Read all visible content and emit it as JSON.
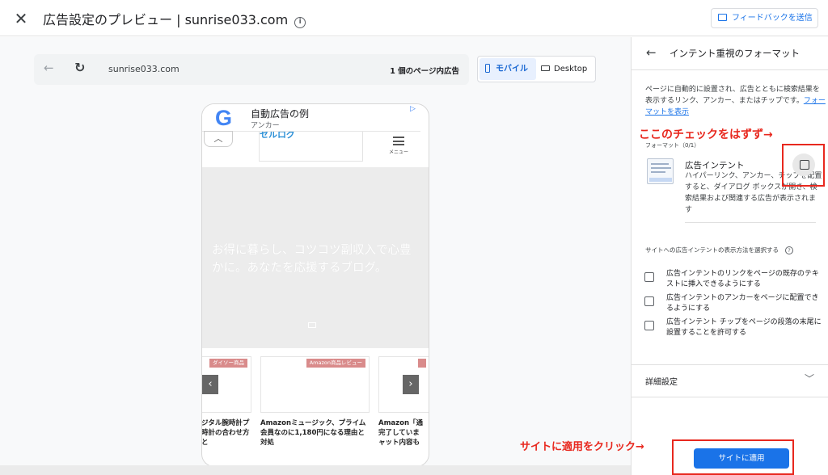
{
  "header": {
    "close_icon": "close-icon",
    "title": "広告設定のプレビュー | sunrise033.com",
    "info_icon": "info-icon",
    "feedback_label": "フィードバックを送信"
  },
  "preview_bar": {
    "url": "sunrise033.com",
    "ad_count": "1 個のページ内広告",
    "device_mobile": "モバイル",
    "device_desktop": "Desktop"
  },
  "phone": {
    "ad_title": "自動広告の例",
    "ad_subtitle": "アンカー",
    "google_logo": "G",
    "menu_label": "メニュー",
    "site_logo": "セルログ",
    "hero_text": "お得に暮らし、コツコツ副収入で心豊かに。あなたを応援するブログ。",
    "cards": [
      {
        "tag": "ダイソー商品",
        "caption": "ジタル腕時計プ\n時計の合わせ方と"
      },
      {
        "tag": "Amazon商品レビュー",
        "caption": "Amazonミュージック、プライム会員なのに1,180円になる理由と対処"
      },
      {
        "tag": "",
        "caption": "Amazon「通\n完了していま\nャット内容も"
      }
    ],
    "prev_label": "‹",
    "next_label": "›"
  },
  "panel": {
    "title": "インテント重視のフォーマット",
    "description": "ページに自動的に設置され、広告とともに検索結果を表示するリンク、アンカー、またはチップです。",
    "description_link": "フォーマットを表示",
    "format_count": "フォーマット（0/1）",
    "format_name": "広告インテント",
    "format_description": "ハイパーリンク、アンカー、チップを配置すると、ダイアログ ボックスが開き、検索結果および関連する広告が表示されます",
    "display_label": "サイトへの広告インテントの表示方法を選択する",
    "options": [
      "広告インテントのリンクをページの既存のテキストに挿入できるようにする",
      "広告インテントのアンカーをページに配置できるようにする",
      "広告インテント チップをページの段落の末尾に設置することを許可する"
    ],
    "advanced": "詳細設定",
    "apply": "サイトに適用"
  },
  "annotations": {
    "uncheck_note": "ここのチェックをはずず→",
    "apply_note": "サイトに適用をクリック→",
    "color": "#e8281e"
  }
}
